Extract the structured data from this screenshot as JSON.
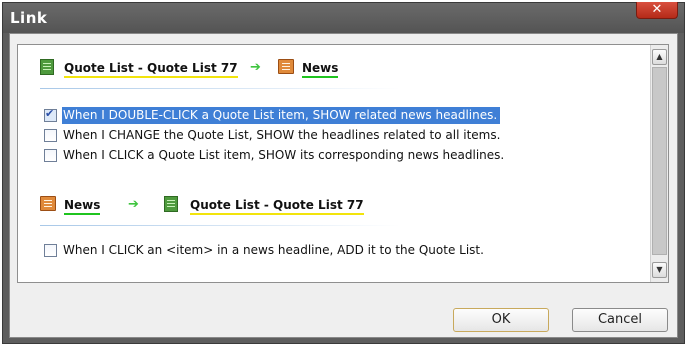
{
  "dialog": {
    "title": "Link",
    "close_glyph": "✕"
  },
  "sections": [
    {
      "source": "Quote List - Quote List 77",
      "target": "News",
      "source_icon": "quote-list-icon",
      "target_icon": "news-icon",
      "options": [
        {
          "label": "When I DOUBLE-CLICK a Quote List item, SHOW related news headlines.",
          "checked": true,
          "selected": true
        },
        {
          "label": "When I CHANGE the Quote List, SHOW the headlines related to all items.",
          "checked": false,
          "selected": false
        },
        {
          "label": "When I CLICK a Quote List item, SHOW its corresponding news headlines.",
          "checked": false,
          "selected": false
        }
      ]
    },
    {
      "source": "News",
      "target": "Quote List - Quote List 77",
      "source_icon": "news-icon",
      "target_icon": "quote-list-icon",
      "options": [
        {
          "label": "When I CLICK an <item> in a news headline, ADD it to the Quote List.",
          "checked": false,
          "selected": false
        }
      ]
    }
  ],
  "buttons": {
    "ok": "OK",
    "cancel": "Cancel"
  },
  "colors": {
    "titlebar": "#5e5e5e",
    "selection": "#3f7fd6",
    "quote_underline": "#f2e40c",
    "news_underline": "#1fc41f",
    "arrow": "#3ec43e"
  }
}
